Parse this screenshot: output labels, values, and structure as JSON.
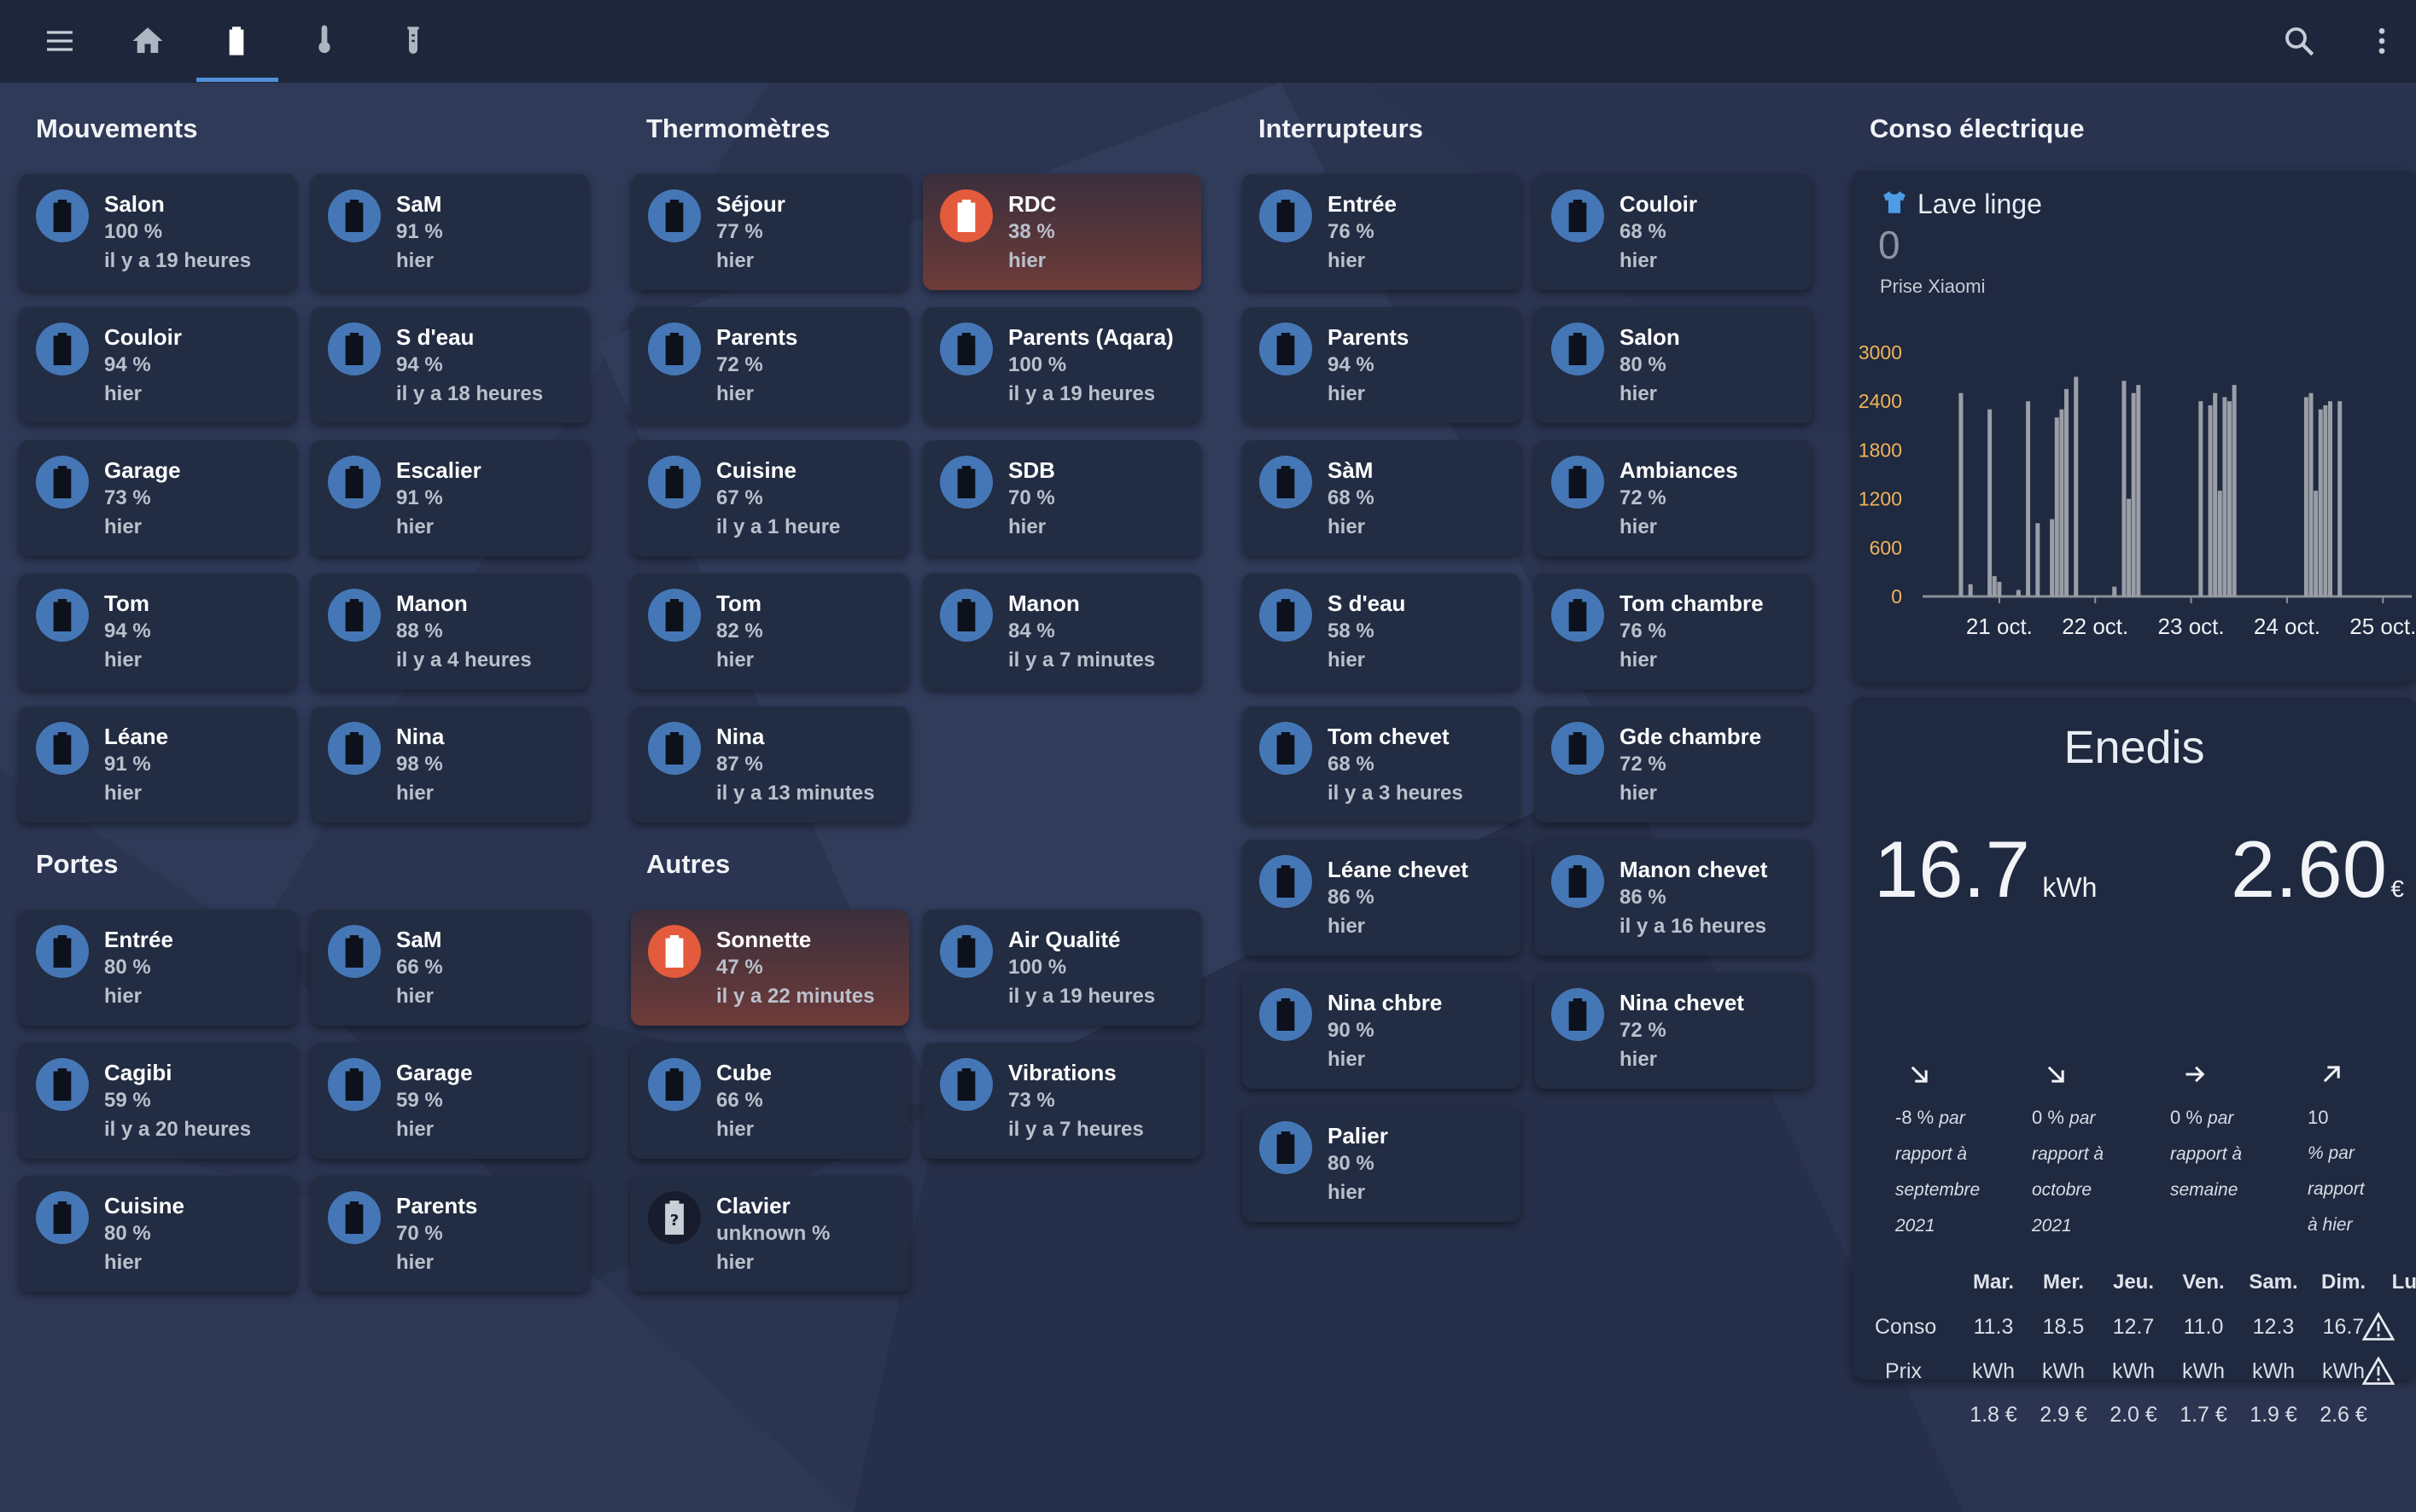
{
  "topbar": {
    "icons": [
      "menu-icon",
      "home-icon",
      "battery-icon",
      "thermometer-icon",
      "test-tube-icon"
    ],
    "right_icons": [
      "search-icon",
      "more-vert-icon"
    ]
  },
  "colors": {
    "background": "#2b3551",
    "topbar": "#1d263a",
    "card": "#222c42",
    "accent": "#4577b6",
    "alert": "#e45a3c",
    "chart_label": "#f0b35a"
  },
  "sections": {
    "mouvements": {
      "title": "Mouvements",
      "cards": [
        {
          "name": "Salon",
          "level": "100 %",
          "time": "il y a 19 heures"
        },
        {
          "name": "SaM",
          "level": "91 %",
          "time": "hier"
        },
        {
          "name": "Couloir",
          "level": "94 %",
          "time": "hier"
        },
        {
          "name": "S d'eau",
          "level": "94 %",
          "time": "il y a 18 heures"
        },
        {
          "name": "Garage",
          "level": "73 %",
          "time": "hier"
        },
        {
          "name": "Escalier",
          "level": "91 %",
          "time": "hier"
        },
        {
          "name": "Tom",
          "level": "94 %",
          "time": "hier"
        },
        {
          "name": "Manon",
          "level": "88 %",
          "time": "il y a 4 heures"
        },
        {
          "name": "Léane",
          "level": "91 %",
          "time": "hier"
        },
        {
          "name": "Nina",
          "level": "98 %",
          "time": "hier"
        }
      ]
    },
    "portes": {
      "title": "Portes",
      "cards": [
        {
          "name": "Entrée",
          "level": "80 %",
          "time": "hier"
        },
        {
          "name": "SaM",
          "level": "66 %",
          "time": "hier"
        },
        {
          "name": "Cagibi",
          "level": "59 %",
          "time": "il y a 20 heures"
        },
        {
          "name": "Garage",
          "level": "59 %",
          "time": "hier"
        },
        {
          "name": "Cuisine",
          "level": "80 %",
          "time": "hier"
        },
        {
          "name": "Parents",
          "level": "70 %",
          "time": "hier"
        }
      ]
    },
    "thermometres": {
      "title": "Thermomètres",
      "cards": [
        {
          "name": "Séjour",
          "level": "77 %",
          "time": "hier"
        },
        {
          "name": "RDC",
          "level": "38 %",
          "time": "hier",
          "alert": true
        },
        {
          "name": "Parents",
          "level": "72 %",
          "time": "hier"
        },
        {
          "name": "Parents (Aqara)",
          "level": "100 %",
          "time": "il y a 19 heures"
        },
        {
          "name": "Cuisine",
          "level": "67 %",
          "time": "il y a 1 heure"
        },
        {
          "name": "SDB",
          "level": "70 %",
          "time": "hier"
        },
        {
          "name": "Tom",
          "level": "82 %",
          "time": "hier"
        },
        {
          "name": "Manon",
          "level": "84 %",
          "time": "il y a 7 minutes"
        },
        {
          "name": "Nina",
          "level": "87 %",
          "time": "il y a 13 minutes"
        }
      ]
    },
    "autres": {
      "title": "Autres",
      "cards": [
        {
          "name": "Sonnette",
          "level": "47 %",
          "time": "il y a 22 minutes",
          "alert": true
        },
        {
          "name": "Air Qualité",
          "level": "100 %",
          "time": "il y a 19 heures"
        },
        {
          "name": "Cube",
          "level": "66 %",
          "time": "hier"
        },
        {
          "name": "Vibrations",
          "level": "73 %",
          "time": "il y a 7 heures"
        },
        {
          "name": "Clavier",
          "level": "unknown %",
          "time": "hier",
          "unknown": true
        }
      ]
    },
    "interrupteurs": {
      "title": "Interrupteurs",
      "cards": [
        {
          "name": "Entrée",
          "level": "76 %",
          "time": "hier"
        },
        {
          "name": "Couloir",
          "level": "68 %",
          "time": "hier"
        },
        {
          "name": "Parents",
          "level": "94 %",
          "time": "hier"
        },
        {
          "name": "Salon",
          "level": "80 %",
          "time": "hier"
        },
        {
          "name": "SàM",
          "level": "68 %",
          "time": "hier"
        },
        {
          "name": "Ambiances",
          "level": "72 %",
          "time": "hier"
        },
        {
          "name": "S d'eau",
          "level": "58 %",
          "time": "hier"
        },
        {
          "name": "Tom chambre",
          "level": "76 %",
          "time": "hier"
        },
        {
          "name": "Tom chevet",
          "level": "68 %",
          "time": "il y a 3 heures"
        },
        {
          "name": "Gde chambre",
          "level": "72 %",
          "time": "hier"
        },
        {
          "name": "Léane chevet",
          "level": "86 %",
          "time": "hier"
        },
        {
          "name": "Manon chevet",
          "level": "86 %",
          "time": "il y a 16 heures"
        },
        {
          "name": "Nina chbre",
          "level": "90 %",
          "time": "hier"
        },
        {
          "name": "Nina chevet",
          "level": "72 %",
          "time": "hier"
        },
        {
          "name": "Palier",
          "level": "80 %",
          "time": "hier"
        }
      ]
    },
    "conso": {
      "title": "Conso électrique"
    }
  },
  "conso_card": {
    "icon": "tshirt-icon",
    "title": "Lave linge",
    "value": "0",
    "subtitle": "Prise Xiaomi"
  },
  "chart_data": {
    "type": "bar",
    "xlabel": "",
    "ylabel": "",
    "ylim": [
      0,
      3000
    ],
    "yticks": [
      "3000",
      "2400",
      "1800",
      "1200",
      "600",
      "0"
    ],
    "xticks": [
      "21 oct.",
      "22 oct.",
      "23 oct.",
      "24 oct.",
      "25 oct."
    ],
    "series": [
      {
        "x": [
          20.6,
          20.7,
          20.9,
          20.95,
          21.0,
          21.2,
          21.3,
          21.4,
          21.55,
          21.6,
          21.65,
          21.7,
          21.8,
          22.2,
          22.3,
          22.35,
          22.4,
          22.45,
          23.1,
          23.2,
          23.25,
          23.3,
          23.35,
          23.4,
          23.45,
          24.2,
          24.25,
          24.3,
          24.35,
          24.4,
          24.45,
          24.55
        ],
        "values": [
          2500,
          150,
          2300,
          250,
          180,
          80,
          2400,
          900,
          950,
          2200,
          2300,
          2550,
          2700,
          120,
          2650,
          1200,
          2500,
          2600,
          2400,
          2350,
          2500,
          1300,
          2450,
          2400,
          2600,
          2450,
          2500,
          1300,
          2300,
          2350,
          2400,
          2400
        ]
      }
    ]
  },
  "enedis": {
    "title": "Enedis",
    "kwh": "16.7",
    "kwh_unit": "kWh",
    "cost": "2.60",
    "cost_unit": "€",
    "evolutions": [
      {
        "icon": "arrow-down-right-icon",
        "value": "-8 %",
        "lines": [
          "par",
          "rapport à",
          "septembre",
          "2021"
        ]
      },
      {
        "icon": "arrow-down-right-icon",
        "value": "0 %",
        "lines": [
          "par",
          "rapport à",
          "octobre",
          "2021"
        ]
      },
      {
        "icon": "arrow-right-icon",
        "value": "0 %",
        "lines": [
          "par",
          "rapport à",
          "semaine"
        ]
      },
      {
        "icon": "arrow-up-right-icon",
        "value": "10",
        "lines": [
          "% par",
          "rapport",
          "à hier"
        ]
      }
    ],
    "table": {
      "days": [
        "Mar.",
        "Mer.",
        "Jeu.",
        "Ven.",
        "Sam.",
        "Dim.",
        "Lun."
      ],
      "row_conso_label": "Conso",
      "row_prix_label": "Prix",
      "conso": [
        "11.3",
        "18.5",
        "12.7",
        "11.0",
        "12.3",
        "16.7"
      ],
      "kwh": [
        "kWh",
        "kWh",
        "kWh",
        "kWh",
        "kWh",
        "kWh"
      ],
      "prix": [
        "1.8 €",
        "2.9 €",
        "2.0 €",
        "1.7 €",
        "1.9 €",
        "2.6 €"
      ]
    }
  }
}
